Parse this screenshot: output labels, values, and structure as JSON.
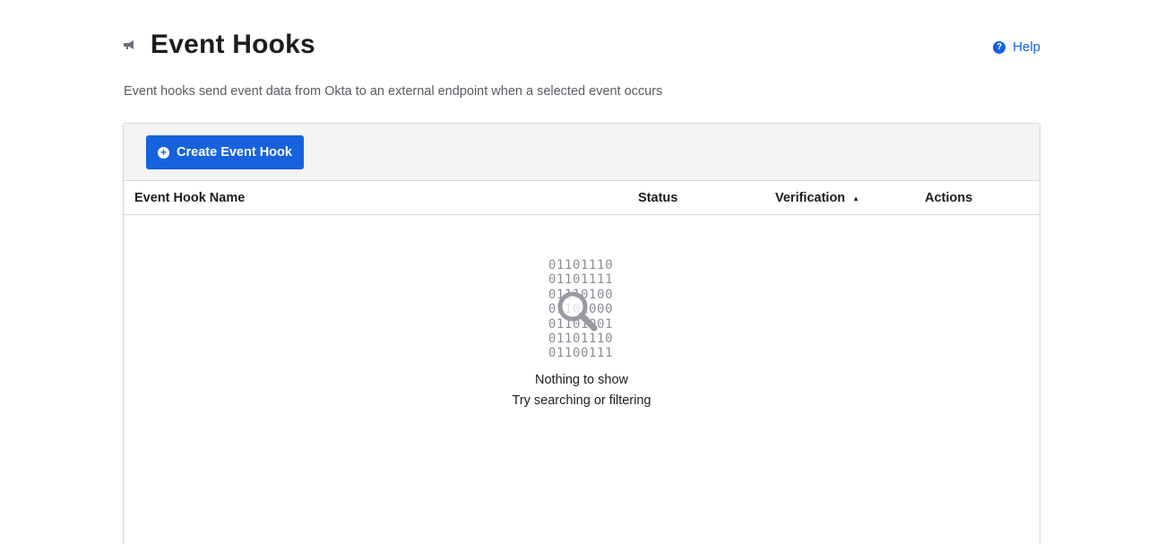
{
  "header": {
    "title": "Event Hooks",
    "title_icon": "megaphone-icon",
    "help_label": "Help",
    "help_icon": "question-circle-icon"
  },
  "description": "Event hooks send event data from Okta to an external endpoint when a selected event occurs",
  "toolbar": {
    "create_label": "Create Event Hook",
    "create_icon": "plus-circle-icon"
  },
  "table": {
    "columns": [
      "Event Hook Name",
      "Status",
      "Verification",
      "Actions"
    ],
    "sorted_column": "Verification",
    "sort_direction": "ascending"
  },
  "empty_state": {
    "binary": [
      "01101110",
      "01101111",
      "01110100",
      "01101000",
      "01101001",
      "01101110",
      "01100111"
    ],
    "title": "Nothing to show",
    "hint": "Try searching or filtering",
    "icon": "magnifier-icon"
  },
  "colors": {
    "accent": "#1662dd",
    "text": "#1d1d21",
    "muted": "#5a5a62",
    "toolbar_bg": "#f4f4f5",
    "border": "#d7d7dc"
  }
}
